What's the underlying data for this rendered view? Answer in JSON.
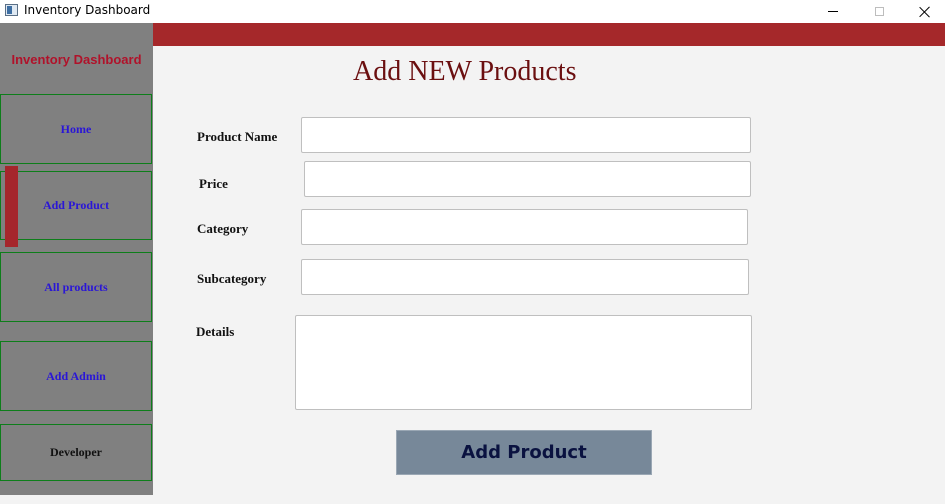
{
  "window": {
    "title": "Inventory Dashboard"
  },
  "sidebar": {
    "header": "Inventory Dashboard",
    "items": [
      {
        "label": "Home"
      },
      {
        "label": "Add Product"
      },
      {
        "label": "All products"
      },
      {
        "label": "Add Admin"
      },
      {
        "label": "Developer"
      }
    ],
    "active_item": "Add Product"
  },
  "form": {
    "title": "Add NEW Products",
    "fields": {
      "product_name": {
        "label": "Product Name",
        "value": ""
      },
      "price": {
        "label": "Price",
        "value": ""
      },
      "category": {
        "label": "Category",
        "value": ""
      },
      "subcategory": {
        "label": "Subcategory",
        "value": ""
      },
      "details": {
        "label": "Details",
        "value": ""
      }
    },
    "submit_label": "Add Product"
  },
  "colors": {
    "banner": "#a5282a",
    "sidebar_bg": "#808080",
    "active_marker": "#a5262c",
    "nav_text": "#2a16d6",
    "title_text": "#6b0f10",
    "button_bg": "#778899"
  }
}
